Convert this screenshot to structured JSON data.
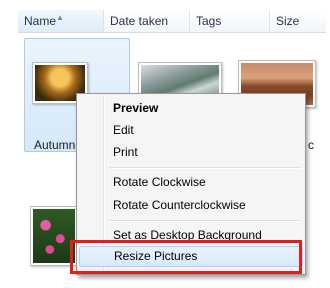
{
  "columns": {
    "name": "Name",
    "date_taken": "Date taken",
    "tags": "Tags",
    "size": "Size"
  },
  "files": {
    "selected_label": "Autumn",
    "right_label_fragment": "c"
  },
  "context_menu": {
    "items": [
      {
        "label": "Preview",
        "bold": true
      },
      {
        "label": "Edit"
      },
      {
        "label": "Print"
      },
      {
        "label": "Rotate Clockwise"
      },
      {
        "label": "Rotate Counterclockwise"
      },
      {
        "label": "Set as Desktop Background"
      },
      {
        "label": "Resize Pictures",
        "highlighted": true
      }
    ]
  },
  "colors": {
    "selection": "#d5e8f8",
    "highlight_box": "#e02020",
    "hover": "#d7e9fa"
  }
}
